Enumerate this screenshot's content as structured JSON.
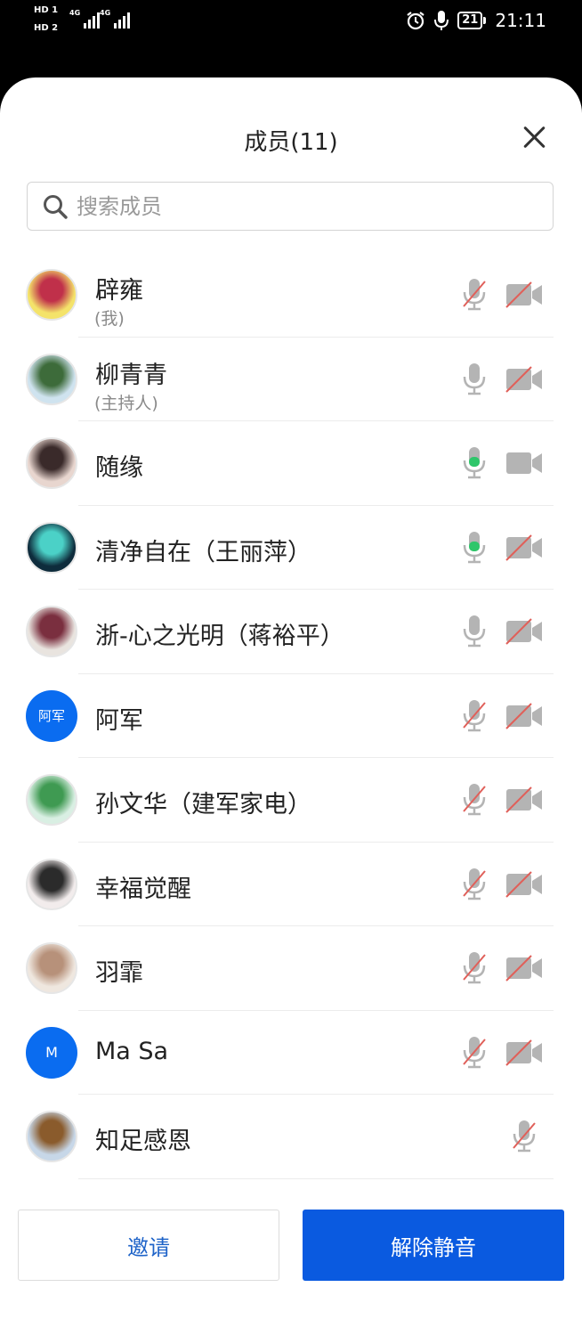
{
  "status_bar": {
    "sim1": "HD 1",
    "sim2": "HD 2",
    "network1": "4G",
    "network2": "4G",
    "battery": "21",
    "time": "21:11"
  },
  "header": {
    "title": "成员(11)"
  },
  "search": {
    "placeholder": "搜索成员",
    "value": ""
  },
  "members": [
    {
      "name": "辟雍",
      "role": "(我)",
      "avatar": "photo",
      "avatar_colors": [
        "#f4e36a",
        "#c0304a"
      ],
      "mic": "muted",
      "camera": "off"
    },
    {
      "name": "柳青青",
      "role": "(主持人)",
      "avatar": "photo",
      "avatar_colors": [
        "#cfe3ef",
        "#3d6b3a"
      ],
      "mic": "idle",
      "camera": "off"
    },
    {
      "name": "随缘",
      "role": "",
      "avatar": "photo",
      "avatar_colors": [
        "#e8d6cf",
        "#3a2a2a"
      ],
      "mic": "speaking",
      "camera": "on"
    },
    {
      "name": "清净自在（王丽萍）",
      "role": "",
      "avatar": "photo",
      "avatar_colors": [
        "#0e2c3c",
        "#4bd1c7"
      ],
      "mic": "speaking",
      "camera": "off"
    },
    {
      "name": "浙-心之光明（蒋裕平）",
      "role": "",
      "avatar": "photo",
      "avatar_colors": [
        "#e9e4df",
        "#7a2f3f"
      ],
      "mic": "idle",
      "camera": "off"
    },
    {
      "name": "阿军",
      "role": "",
      "avatar": "text",
      "avatar_text": "阿军",
      "avatar_color": "#0a6cf0",
      "mic": "muted",
      "camera": "off"
    },
    {
      "name": "孙文华（建军家电）",
      "role": "",
      "avatar": "photo",
      "avatar_colors": [
        "#d9efe3",
        "#3f9a52"
      ],
      "mic": "muted",
      "camera": "off"
    },
    {
      "name": "幸福觉醒",
      "role": "",
      "avatar": "photo",
      "avatar_colors": [
        "#f2ecec",
        "#2b2b2b"
      ],
      "mic": "muted",
      "camera": "off"
    },
    {
      "name": "羽霏",
      "role": "",
      "avatar": "photo",
      "avatar_colors": [
        "#efe7df",
        "#b7917a"
      ],
      "mic": "muted",
      "camera": "off"
    },
    {
      "name": "Ma Sa",
      "role": "",
      "avatar": "text",
      "avatar_text": "M",
      "avatar_color": "#0a6cf0",
      "mic": "muted",
      "camera": "off"
    },
    {
      "name": "知足感恩",
      "role": "",
      "avatar": "photo",
      "avatar_colors": [
        "#c7d7e8",
        "#8a5b2c"
      ],
      "mic": "muted",
      "camera": "none"
    }
  ],
  "buttons": {
    "invite": "邀请",
    "unmute": "解除静音"
  },
  "colors": {
    "accent": "#0a5ae0",
    "speaking": "#2ec66a",
    "muted_slash": "#e0605a",
    "icon_gray": "#b4b4b4"
  }
}
